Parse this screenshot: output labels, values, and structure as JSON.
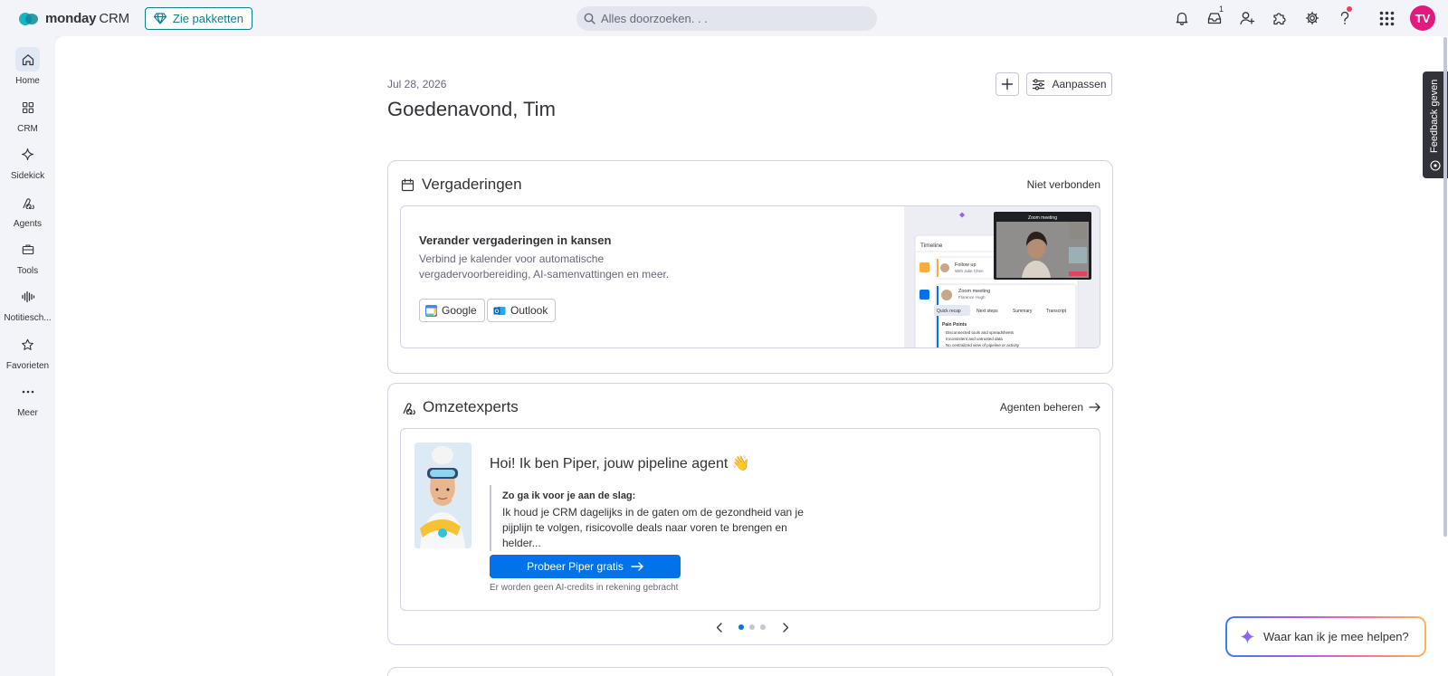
{
  "brand": {
    "name": "monday",
    "product": "CRM"
  },
  "header": {
    "plans_label": "Zie pakketten",
    "search_placeholder": "Alles doorzoeken. . .",
    "inbox_badge": "1",
    "avatar_initials": "TV"
  },
  "nav": {
    "items": [
      {
        "label": "Home",
        "icon": "home-icon"
      },
      {
        "label": "CRM",
        "icon": "grid-icon"
      },
      {
        "label": "Sidekick",
        "icon": "sparkle-icon"
      },
      {
        "label": "Agents",
        "icon": "agents-icon"
      },
      {
        "label": "Tools",
        "icon": "briefcase-icon"
      },
      {
        "label": "Notitiesch...",
        "icon": "audio-wave-icon"
      },
      {
        "label": "Favorieten",
        "icon": "star-icon"
      },
      {
        "label": "Meer",
        "icon": "more-icon"
      }
    ]
  },
  "home": {
    "date": "Jul 28, 2026",
    "greeting": "Goedenavond, Tim",
    "customize_label": "Aanpassen"
  },
  "meetings": {
    "title": "Vergaderingen",
    "status": "Niet verbonden",
    "promo_title": "Verander vergaderingen in kansen",
    "promo_desc": "Verbind je kalender voor automatische vergadervoorbereiding, AI-samenvattingen en meer.",
    "google_label": "Google",
    "outlook_label": "Outlook",
    "preview": {
      "timeline_label": "Timeline",
      "video_label": "Zoom meeting",
      "item1_title": "Follow up",
      "item1_sub": "With Julie Chen",
      "item2_title": "Zoom meeting",
      "item2_sub": "Florence Hugh",
      "tabs": [
        "Quick recap",
        "Next steps",
        "Summary",
        "Transcript"
      ],
      "pain_title": "Pain Points",
      "pain_items": [
        "Disconnected tools and spreadsheets",
        "Inconsistent and untrusted data",
        "No centralized view of pipeline or activity"
      ]
    }
  },
  "experts": {
    "title": "Omzetexperts",
    "manage_label": "Agenten beheren",
    "agent_title": "Hoi! Ik ben Piper, jouw pipeline agent 👋",
    "quote_title": "Zo ga ik voor je aan de slag:",
    "quote_text": "Ik houd je CRM dagelijks in de gaten om de gezondheid van je pijplijn te volgen, risicovolle deals naar voren te brengen en helder...",
    "cta_label": "Probeer Piper gratis",
    "credits_note": "Er worden geen AI-credits in rekening gebracht",
    "pager": {
      "total": 3,
      "active": 1
    }
  },
  "feedback_label": "Feedback geven",
  "assistant_label": "Waar kan ik je mee helpen?",
  "colors": {
    "primary": "#0073ea",
    "teal": "#0f7f8c",
    "avatar": "#e2197f",
    "text": "#323338"
  }
}
